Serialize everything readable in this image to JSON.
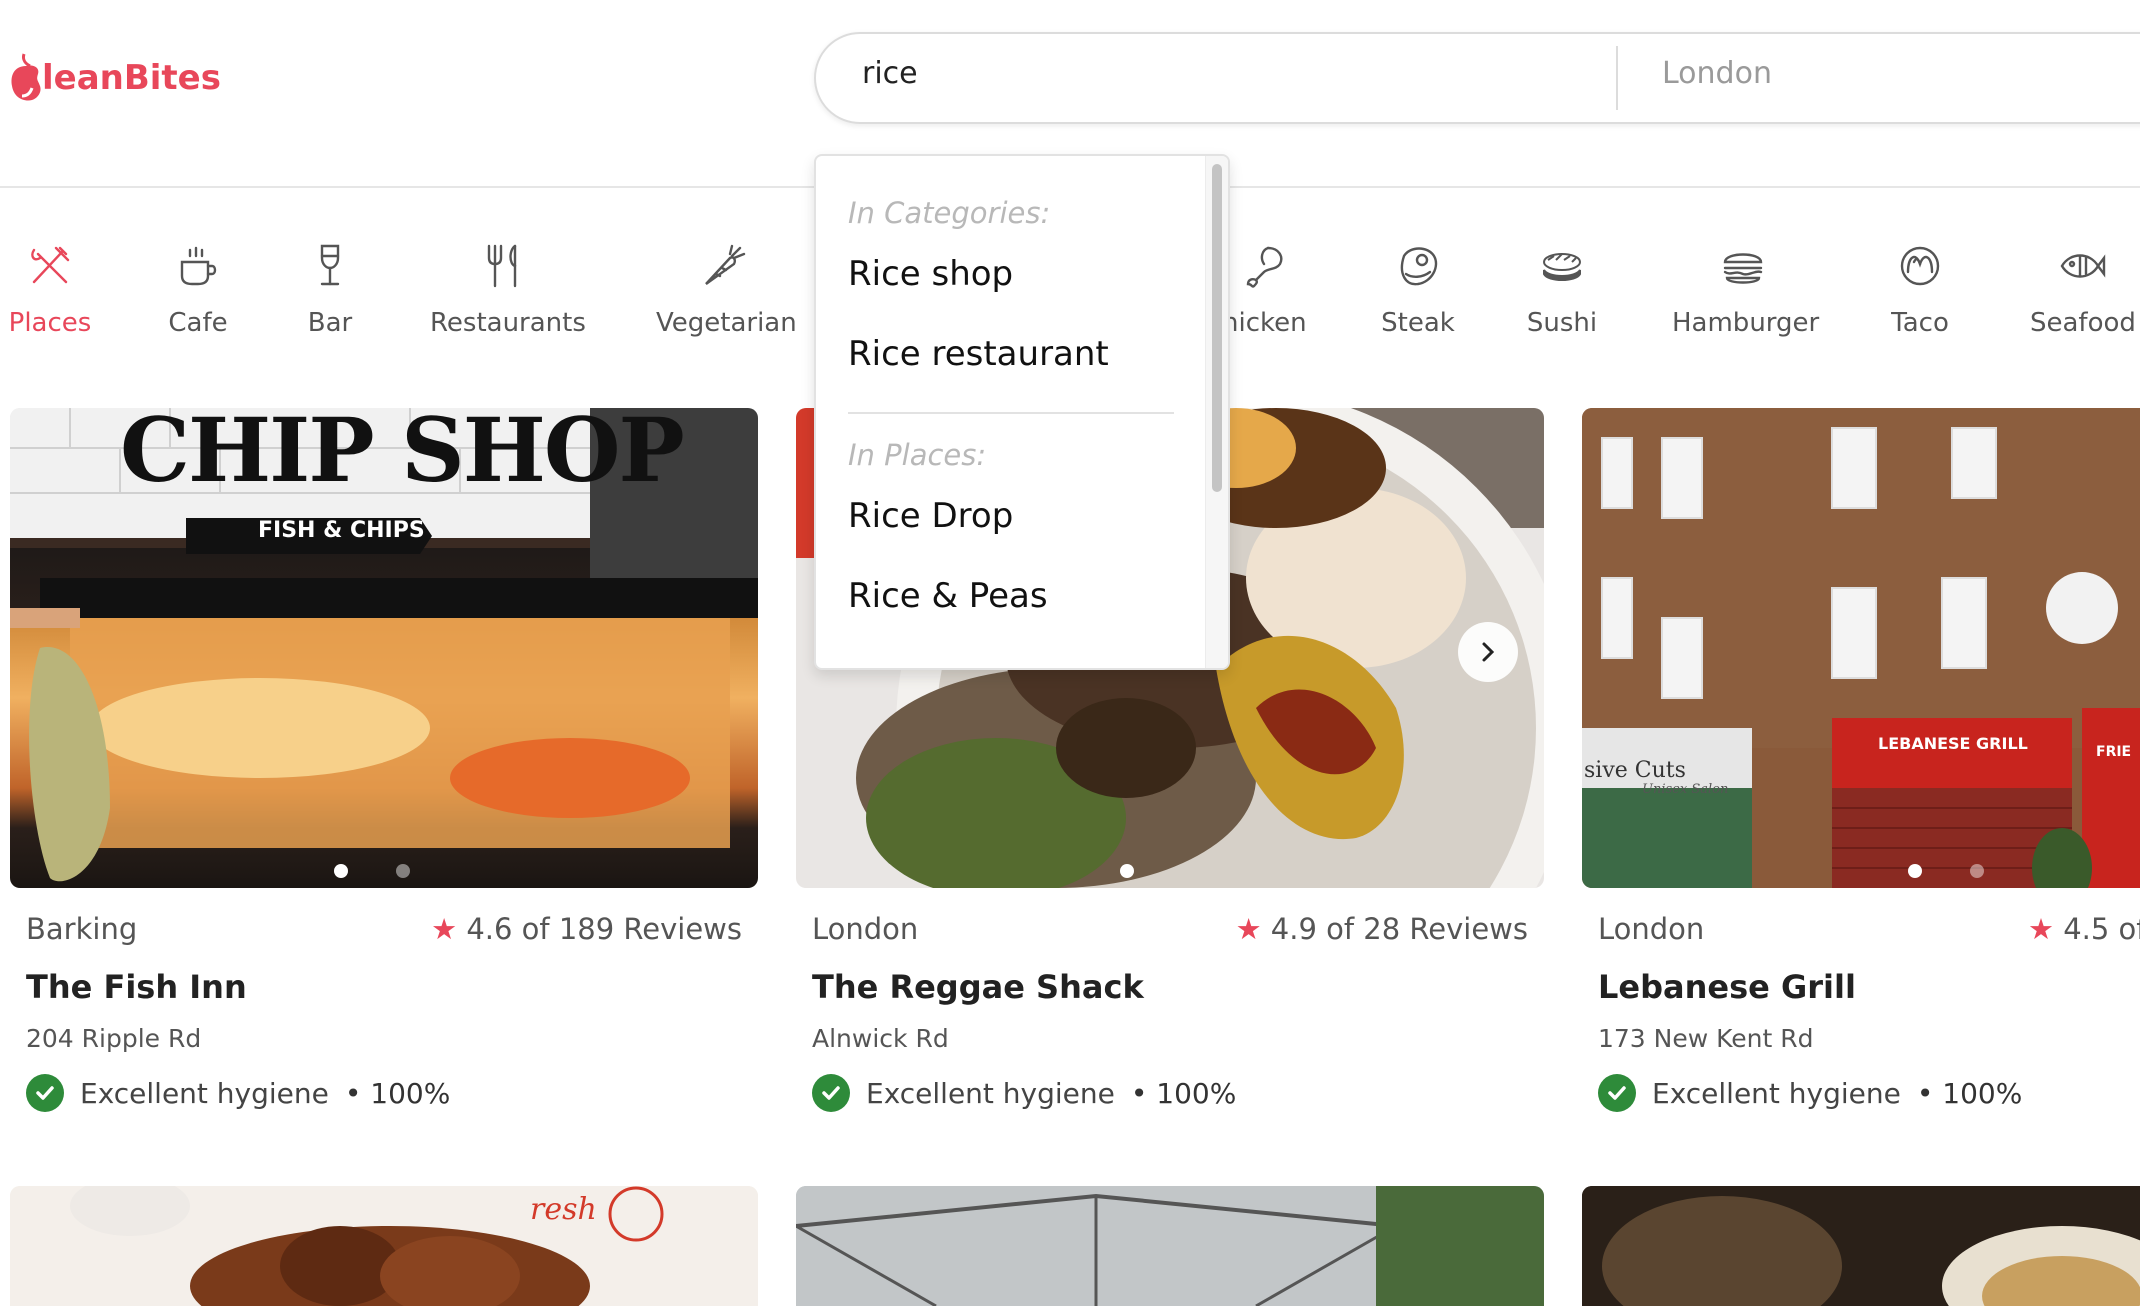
{
  "app": {
    "logo_text": "leanBites",
    "brand_color": "#e8475a"
  },
  "search": {
    "query": "rice",
    "location_placeholder": "London"
  },
  "dropdown": {
    "categories_heading": "In Categories:",
    "categories": [
      "Rice shop",
      "Rice restaurant"
    ],
    "places_heading": "In Places:",
    "places": [
      "Rice Drop",
      "Rice & Peas"
    ]
  },
  "categories": [
    {
      "label": "Places",
      "icon": "cutlery-cross-icon",
      "active": true
    },
    {
      "label": "Cafe",
      "icon": "coffee-cup-icon"
    },
    {
      "label": "Bar",
      "icon": "wine-glass-icon"
    },
    {
      "label": "Restaurants",
      "icon": "fork-knife-icon"
    },
    {
      "label": "Vegetarian",
      "icon": "carrot-icon"
    },
    {
      "label": "hicken",
      "icon": "chicken-leg-icon"
    },
    {
      "label": "Steak",
      "icon": "steak-icon"
    },
    {
      "label": "Sushi",
      "icon": "sushi-icon"
    },
    {
      "label": "Hamburger",
      "icon": "hamburger-icon"
    },
    {
      "label": "Taco",
      "icon": "taco-icon"
    },
    {
      "label": "Seafood",
      "icon": "fish-icon"
    }
  ],
  "places": [
    {
      "city": "Barking",
      "rating": "4.6 of 189 Reviews",
      "name": "The Fish Inn",
      "address": "204 Ripple Rd",
      "hygiene": "Excellent hygiene",
      "hygiene_pct": "• 100%",
      "photo_text": "CHIP SHOP",
      "photo_subtext": "FISH & CHIPS"
    },
    {
      "city": "London",
      "rating": "4.9 of 28 Reviews",
      "name": "The Reggae Shack",
      "address": "Alnwick Rd",
      "hygiene": "Excellent hygiene",
      "hygiene_pct": "• 100%"
    },
    {
      "city": "London",
      "rating": "4.5 of",
      "name": "Lebanese Grill",
      "address": "173 New Kent Rd",
      "hygiene": "Excellent hygiene",
      "hygiene_pct": "• 100%",
      "sign_left": "sive Cuts",
      "sign_left_sub": "Unisex Salon",
      "sign_right": "LEBANESE GRILL",
      "sign_far_right": "FRIE"
    }
  ],
  "bottom_photos": [
    {
      "text": "resh"
    },
    {
      "text": ""
    },
    {
      "text": ""
    }
  ]
}
